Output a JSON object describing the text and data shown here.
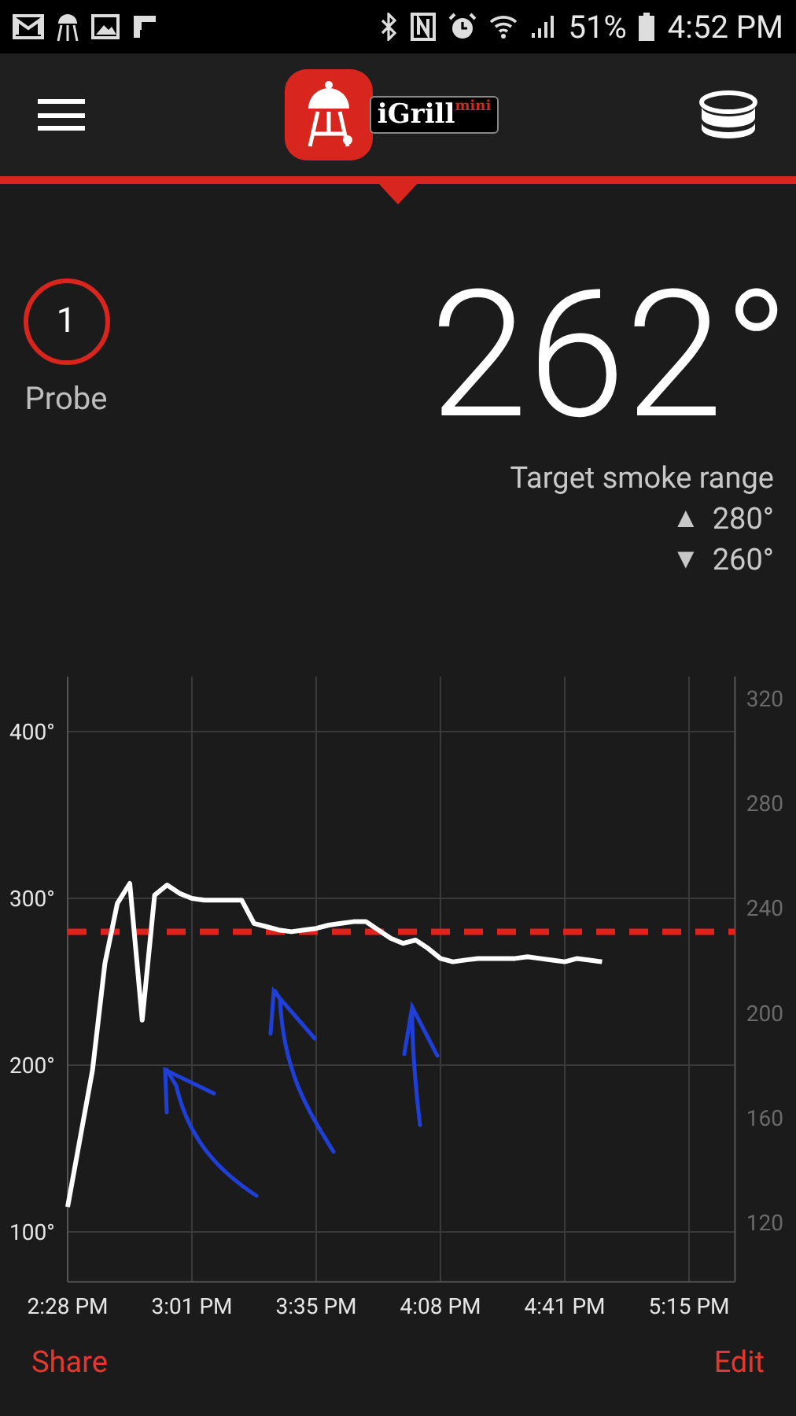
{
  "status_bar": {
    "battery": "51%",
    "time": "4:52 PM"
  },
  "app_bar": {
    "logo_text": "iGrill",
    "logo_suffix": "mini"
  },
  "probe": {
    "number": "1",
    "label": "Probe"
  },
  "temperature": "262°",
  "target": {
    "title": "Target smoke range",
    "high_icon": "▲",
    "high": "280°",
    "low_icon": "▼",
    "low": "260°"
  },
  "chart": {
    "right_axis_labels": [
      "320",
      "280",
      "240",
      "200",
      "160",
      "120"
    ],
    "chart_data": {
      "type": "line",
      "categories": [
        "2:28 PM",
        null,
        null,
        null,
        null,
        null,
        null,
        null,
        null,
        null,
        "3:01 PM",
        null,
        null,
        null,
        null,
        null,
        null,
        null,
        null,
        null,
        "3:35 PM",
        null,
        null,
        null,
        null,
        null,
        null,
        null,
        null,
        null,
        "4:08 PM",
        null,
        null,
        null,
        null,
        null,
        null,
        null,
        null,
        null,
        "4:41 PM",
        null,
        null,
        null,
        null,
        null,
        null,
        null,
        null,
        null,
        "5:15 PM",
        null,
        null,
        null
      ],
      "series": [
        {
          "color": "#ffffff",
          "values": [
            115,
            156,
            197,
            261,
            297,
            309,
            227,
            302,
            308,
            303,
            300,
            299,
            299,
            299,
            299,
            285,
            283,
            281,
            280,
            281,
            282,
            284,
            285,
            286,
            286,
            281,
            276,
            273,
            275,
            270,
            264,
            262,
            263,
            264,
            264,
            264,
            264,
            265,
            264,
            263,
            262,
            264,
            263,
            262,
            null,
            null,
            null,
            null,
            null,
            null,
            null,
            null,
            null,
            null
          ]
        }
      ],
      "ylim": [
        70,
        433
      ],
      "yticks": [
        {
          "value": 100,
          "label": "100°"
        },
        {
          "value": 200,
          "label": "200°"
        },
        {
          "value": 300,
          "label": "300°"
        },
        {
          "value": 400,
          "label": "400°"
        }
      ],
      "grid": true,
      "ref_lines": [
        {
          "axis": "y",
          "value": 280,
          "color": "#e3201b"
        }
      ]
    }
  },
  "footer": {
    "share": "Share",
    "edit": "Edit"
  }
}
